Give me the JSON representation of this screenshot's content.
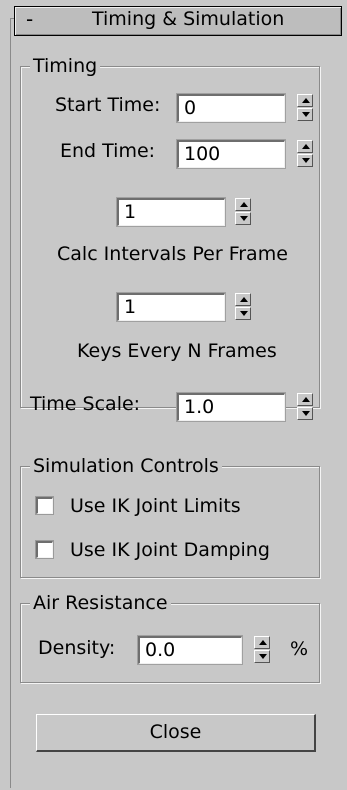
{
  "rollout": {
    "collapse_glyph": "-",
    "title": "Timing & Simulation"
  },
  "timing": {
    "label": "Timing",
    "start_time": {
      "label": "Start Time:",
      "value": "0"
    },
    "end_time": {
      "label": "End Time:",
      "value": "100"
    },
    "calc_intervals": {
      "value": "1",
      "label": "Calc Intervals Per Frame"
    },
    "keys_every": {
      "value": "1",
      "label": "Keys Every N Frames"
    },
    "time_scale": {
      "label": "Time Scale:",
      "value": "1.0"
    }
  },
  "simulation": {
    "label": "Simulation Controls",
    "ik_limits": {
      "label": "Use IK Joint Limits",
      "checked": false
    },
    "ik_damping": {
      "label": "Use IK Joint Damping",
      "checked": false
    }
  },
  "air": {
    "label": "Air Resistance",
    "density": {
      "label": "Density:",
      "value": "0.0",
      "unit": "%"
    }
  },
  "close_label": "Close",
  "icons": {
    "spinner": "spinner-arrows-icon",
    "checkbox": "checkbox-unchecked"
  }
}
